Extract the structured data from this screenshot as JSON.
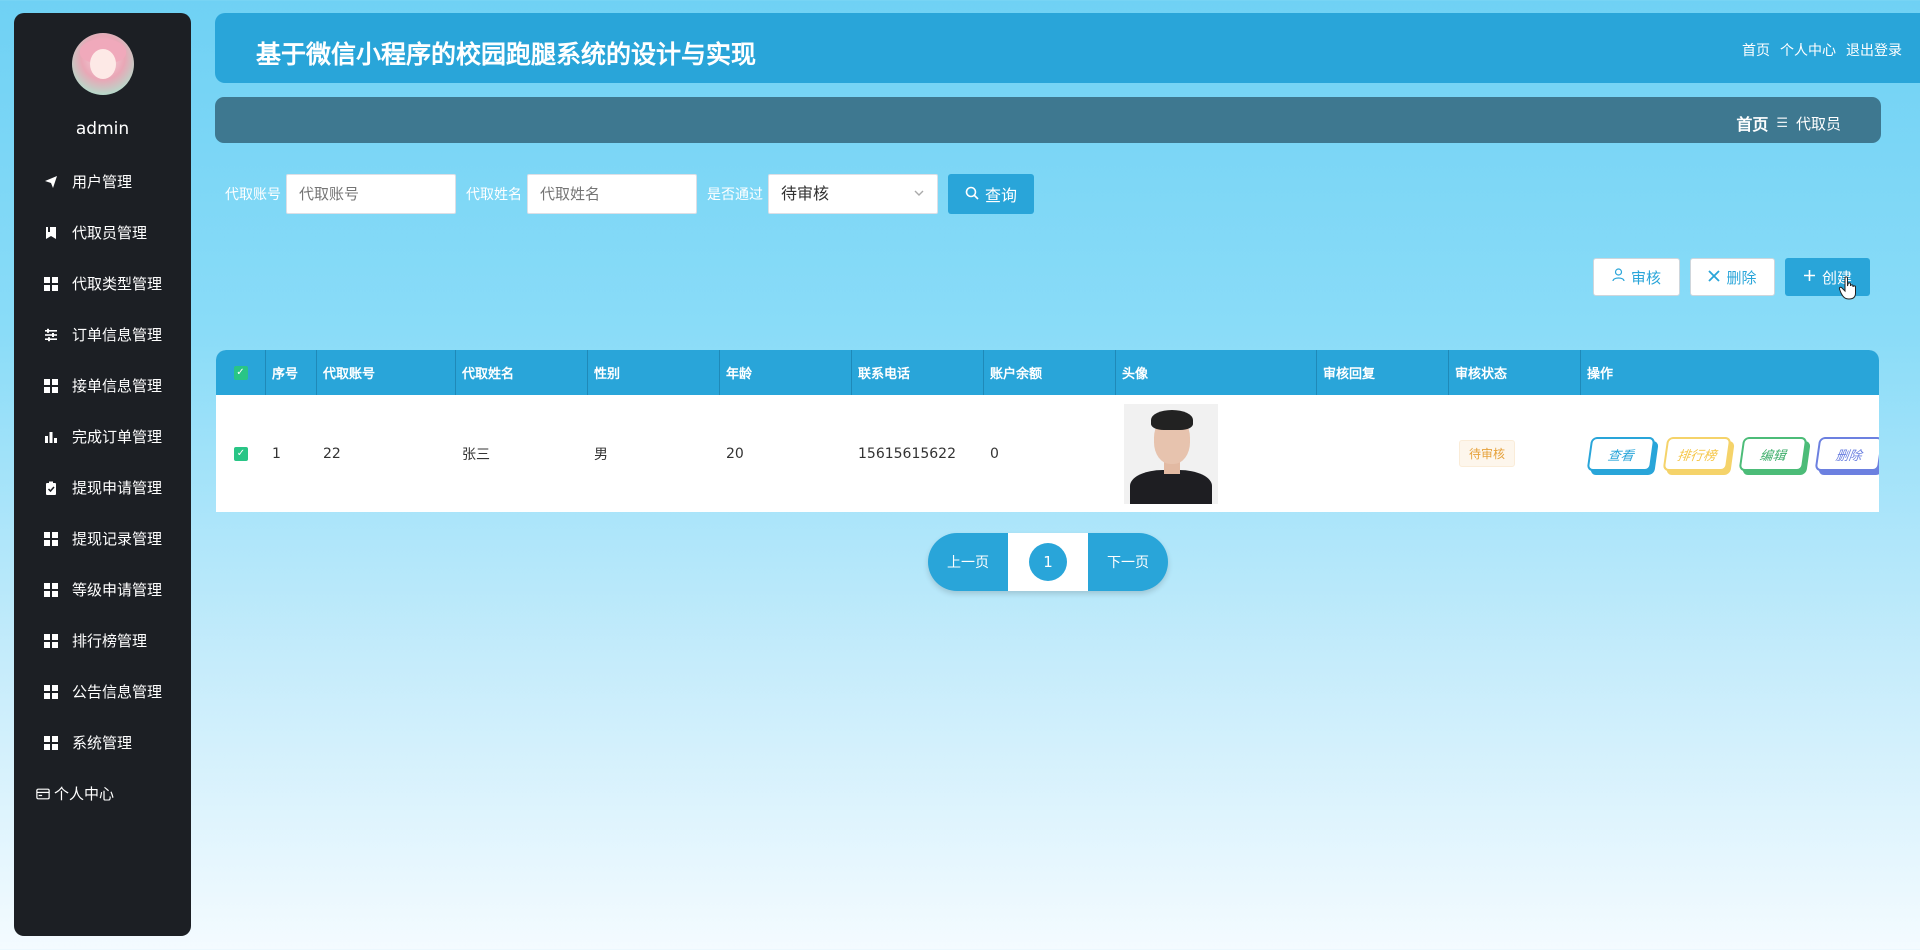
{
  "sidebar": {
    "username": "admin",
    "items": [
      {
        "label": "用户管理",
        "icon": "send-icon"
      },
      {
        "label": "代取员管理",
        "icon": "bookmark-icon"
      },
      {
        "label": "代取类型管理",
        "icon": "grid-icon"
      },
      {
        "label": "订单信息管理",
        "icon": "sliders-icon"
      },
      {
        "label": "接单信息管理",
        "icon": "grid-icon"
      },
      {
        "label": "完成订单管理",
        "icon": "bar-chart-icon"
      },
      {
        "label": "提现申请管理",
        "icon": "clipboard-icon"
      },
      {
        "label": "提现记录管理",
        "icon": "grid-icon"
      },
      {
        "label": "等级申请管理",
        "icon": "grid-icon"
      },
      {
        "label": "排行榜管理",
        "icon": "grid-icon"
      },
      {
        "label": "公告信息管理",
        "icon": "grid-icon"
      },
      {
        "label": "系统管理",
        "icon": "grid-icon"
      }
    ],
    "personal": {
      "label": "个人中心",
      "icon": "card-icon"
    }
  },
  "header": {
    "title": "基于微信小程序的校园跑腿系统的设计与实现",
    "links": [
      "首页",
      "个人中心",
      "退出登录"
    ]
  },
  "breadcrumb": {
    "home": "首页",
    "sep": "☰",
    "current": "代取员"
  },
  "search": {
    "account_label": "代取账号",
    "account_placeholder": "代取账号",
    "name_label": "代取姓名",
    "name_placeholder": "代取姓名",
    "pass_label": "是否通过",
    "pass_value": "待审核",
    "query_label": "查询"
  },
  "actions": {
    "review": "审核",
    "delete": "删除",
    "create": "创建"
  },
  "table": {
    "columns": [
      "序号",
      "代取账号",
      "代取姓名",
      "性别",
      "年龄",
      "联系电话",
      "账户余额",
      "头像",
      "审核回复",
      "审核状态",
      "操作"
    ],
    "rows": [
      {
        "no": "1",
        "account": "22",
        "name": "张三",
        "sex": "男",
        "age": "20",
        "tel": "15615615622",
        "balance": "0",
        "reply": "",
        "status": "待审核",
        "ops": [
          "查看",
          "排行榜",
          "编辑",
          "删除"
        ]
      }
    ]
  },
  "pager": {
    "prev": "上一页",
    "page": "1",
    "next": "下一页"
  },
  "colors": {
    "primary": "#29a5d9",
    "sidebar": "#1c1f24",
    "crumbbar": "#3e7890"
  }
}
